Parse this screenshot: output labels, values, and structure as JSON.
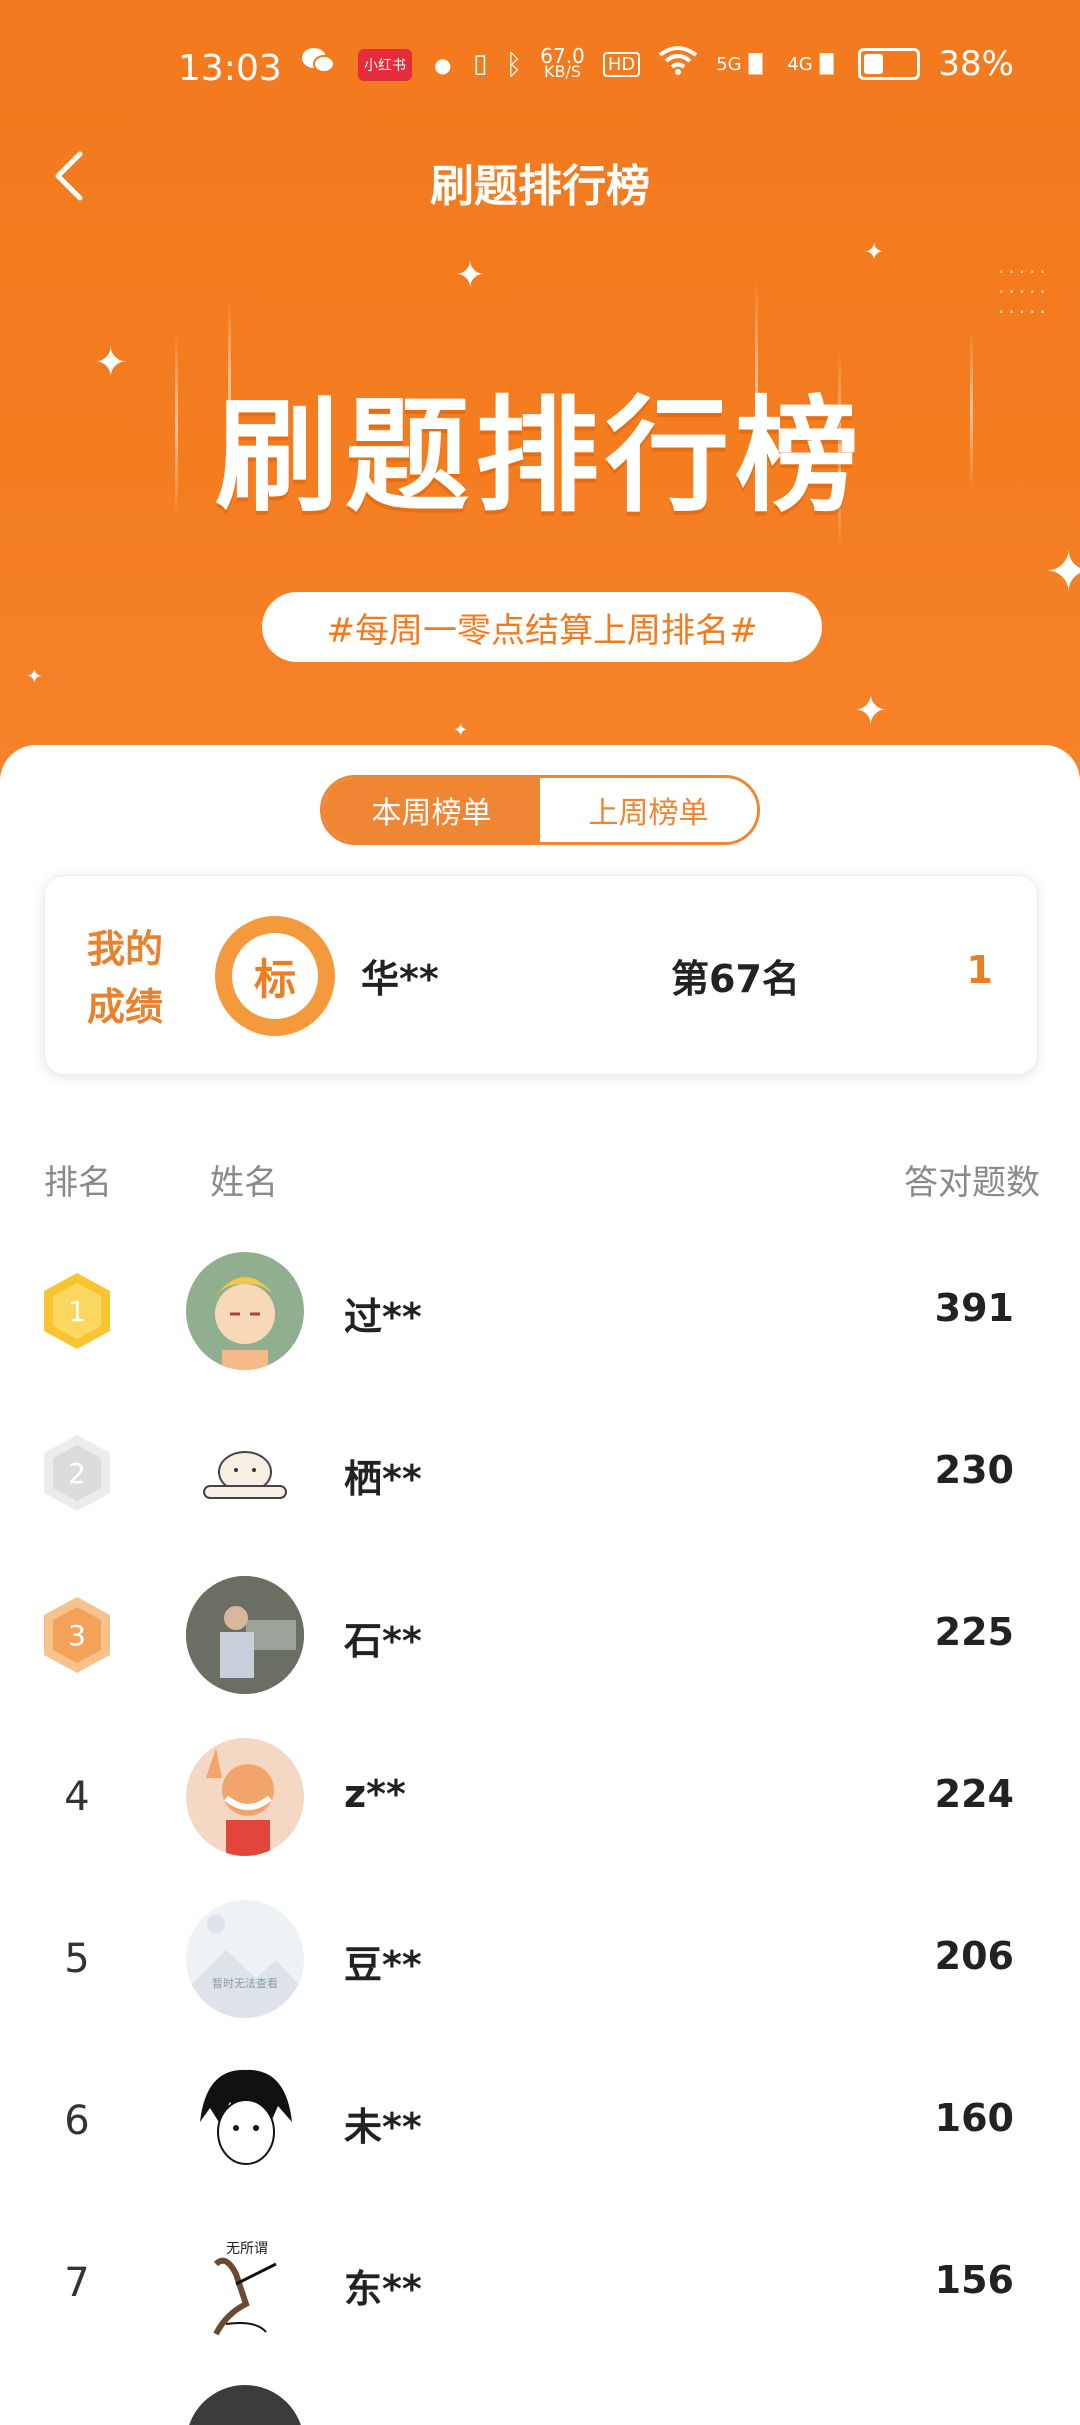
{
  "status_bar": {
    "time": "13:03",
    "app_badge": "小红书",
    "net_speed_value": "67.0",
    "net_speed_unit": "KB/S",
    "hd_label": "HD",
    "signal1": "5G",
    "signal2": "4G",
    "battery_percent": "38%",
    "battery_level": 0.38
  },
  "header": {
    "title": "刷题排行榜",
    "banner_title": "刷题排行榜",
    "banner_subtitle": "#每周一零点结算上周排名#"
  },
  "tabs": [
    {
      "label": "本周榜单",
      "active": true
    },
    {
      "label": "上周榜单",
      "active": false
    }
  ],
  "my_score": {
    "label_line1": "我的",
    "label_line2": "成绩",
    "avatar_char": "标",
    "name": "华**",
    "rank_text": "第67名",
    "score": "1"
  },
  "list_header": {
    "rank": "排名",
    "name": "姓名",
    "count": "答对题数"
  },
  "ranking": [
    {
      "rank": "1",
      "medal": "gold",
      "name": "过**",
      "count": "391",
      "avatar": "cartoon-boy-avatar"
    },
    {
      "rank": "2",
      "medal": "silver",
      "name": "栖**",
      "count": "230",
      "avatar": "dog-bone-avatar"
    },
    {
      "rank": "3",
      "medal": "bronze",
      "name": "石**",
      "count": "225",
      "avatar": "photo-man-avatar"
    },
    {
      "rank": "4",
      "medal": "",
      "name": "z**",
      "count": "224",
      "avatar": "cartoon-player-avatar"
    },
    {
      "rank": "5",
      "medal": "",
      "name": "豆**",
      "count": "206",
      "avatar": "placeholder-avatar",
      "avatar_text": "暂时无法查看"
    },
    {
      "rank": "6",
      "medal": "",
      "name": "未**",
      "count": "160",
      "avatar": "anime-boy-avatar"
    },
    {
      "rank": "7",
      "medal": "",
      "name": "东**",
      "count": "156",
      "avatar": "sketch-avatar",
      "avatar_text": "无所谓"
    }
  ],
  "colors": {
    "brand_orange": "#f37a1e",
    "gold": "#f7c531",
    "silver": "#e3e3e3",
    "bronze": "#f4a25a"
  }
}
